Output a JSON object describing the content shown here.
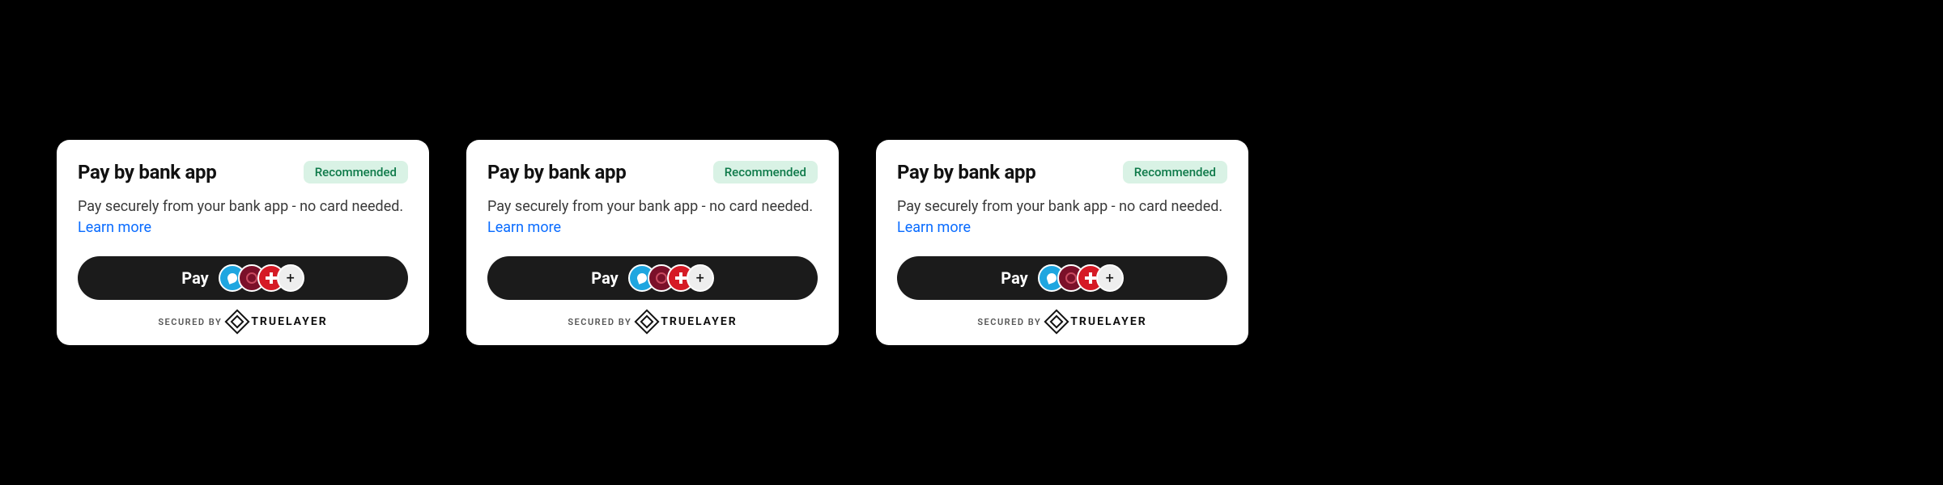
{
  "cards": [
    {
      "title": "Pay by bank app",
      "badge": "Recommended",
      "desc_prefix": "Pay securely from your bank app - no card needed. ",
      "learn_more": "Learn more",
      "pay_label": "Pay",
      "plus_label": "+",
      "secured_label": "SECURED BY",
      "provider": "TRUELAYER"
    },
    {
      "title": "Pay by bank app",
      "badge": "Recommended",
      "desc_prefix": "Pay securely from your bank app - no card needed. ",
      "learn_more": "Learn more",
      "pay_label": "Pay",
      "plus_label": "+",
      "secured_label": "SECURED BY",
      "provider": "TRUELAYER"
    },
    {
      "title": "Pay by bank app",
      "badge": "Recommended",
      "desc_prefix": "Pay securely from your bank app - no card needed. ",
      "learn_more": "Learn more",
      "pay_label": "Pay",
      "plus_label": "+",
      "secured_label": "SECURED BY",
      "provider": "TRUELAYER"
    }
  ]
}
